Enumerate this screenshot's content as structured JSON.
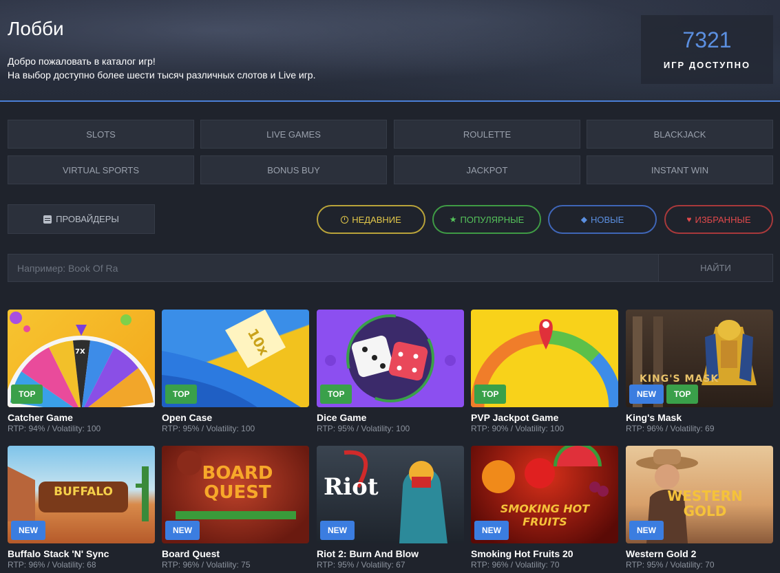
{
  "hero": {
    "title": "Лобби",
    "line1": "Добро пожаловать в каталог игр!",
    "line2": "На выбор доступно более шести тысяч различных слотов и Live игр.",
    "games_count": "7321",
    "games_count_label": "ИГР ДОСТУПНО"
  },
  "categories": [
    "SLOTS",
    "LIVE GAMES",
    "ROULETTE",
    "BLACKJACK",
    "VIRTUAL SPORTS",
    "BONUS BUY",
    "JACKPOT",
    "INSTANT WIN"
  ],
  "filters": {
    "providers": "ПРОВАЙДЕРЫ",
    "recent": "НЕДАВНИЕ",
    "popular": "ПОПУЛЯРНЫЕ",
    "new": "НОВЫЕ",
    "favorites": "ИЗБРАННЫЕ"
  },
  "search": {
    "placeholder": "Например: Book Of Ra",
    "button": "НАЙТИ"
  },
  "games": [
    {
      "name": "Catcher Game",
      "meta": "RTP: 94% / Volatility: 100",
      "badges": [
        "TOP"
      ],
      "art_text": "7X"
    },
    {
      "name": "Open Case",
      "meta": "RTP: 95% / Volatility: 100",
      "badges": [
        "TOP"
      ],
      "art_text": "10x"
    },
    {
      "name": "Dice Game",
      "meta": "RTP: 95% / Volatility: 100",
      "badges": [
        "TOP"
      ],
      "art_text": ""
    },
    {
      "name": "PVP Jackpot Game",
      "meta": "RTP: 90% / Volatility: 100",
      "badges": [
        "TOP"
      ],
      "art_text": ""
    },
    {
      "name": "King's Mask",
      "meta": "RTP: 96% / Volatility: 69",
      "badges": [
        "NEW",
        "TOP"
      ],
      "art_text": "KING'S MASK"
    },
    {
      "name": "Buffalo Stack 'N' Sync",
      "meta": "RTP: 96% / Volatility: 68",
      "badges": [
        "NEW"
      ],
      "art_text": "BUFFALO"
    },
    {
      "name": "Board Quest",
      "meta": "RTP: 96% / Volatility: 75",
      "badges": [
        "NEW"
      ],
      "art_text": "BOARD QUEST"
    },
    {
      "name": "Riot 2: Burn And Blow",
      "meta": "RTP: 95% / Volatility: 67",
      "badges": [
        "NEW"
      ],
      "art_text": "Riot"
    },
    {
      "name": "Smoking Hot Fruits 20",
      "meta": "RTP: 96% / Volatility: 70",
      "badges": [
        "NEW"
      ],
      "art_text": "SMOKING HOT FRUITS"
    },
    {
      "name": "Western Gold 2",
      "meta": "RTP: 95% / Volatility: 70",
      "badges": [
        "NEW"
      ],
      "art_text": "WESTERN GOLD"
    }
  ],
  "colors": {
    "accent_blue": "#5b8fe0",
    "top_badge": "#3aa04a",
    "new_badge": "#3b7de0",
    "recent": "#e3c84a",
    "popular": "#55c45b",
    "favorites": "#e0494b"
  }
}
